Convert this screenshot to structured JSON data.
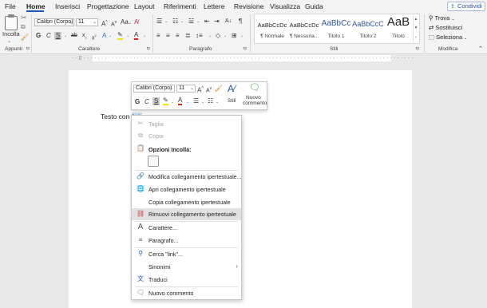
{
  "tabs": [
    "File",
    "Home",
    "Inserisci",
    "Progettazione",
    "Layout",
    "Riferimenti",
    "Lettere",
    "Revisione",
    "Visualizza",
    "Guida"
  ],
  "active_tab": "Home",
  "share_label": "Condividi",
  "clipboard": {
    "paste_label": "Incolla",
    "group_label": "Appunti"
  },
  "font": {
    "name": "Calibri (Corpo)",
    "size": "11",
    "group_label": "Carattere"
  },
  "paragraph": {
    "group_label": "Paragrafo"
  },
  "styles": {
    "group_label": "Stili",
    "items": [
      {
        "preview": "AaBbCcDc",
        "name": "¶ Normale"
      },
      {
        "preview": "AaBbCcDc",
        "name": "¶ Nessuna..."
      },
      {
        "preview": "AaBbCc",
        "name": "Titolo 1"
      },
      {
        "preview": "AaBbCcC",
        "name": "Titolo 2"
      },
      {
        "preview": "AaB",
        "name": "Titolo"
      }
    ]
  },
  "editing": {
    "find": "Trova",
    "replace": "Sostituisci",
    "select": "Seleziona",
    "group_label": "Modifica"
  },
  "document": {
    "text_before": "Testo con ",
    "link_text": "link"
  },
  "minibar": {
    "font_name": "Calibri (Corpo)",
    "font_size": "11",
    "styles_label": "Stili",
    "comment_label_1": "Nuovo",
    "comment_label_2": "commento"
  },
  "context_menu": {
    "cut": "Taglia",
    "copy": "Copia",
    "paste_options": "Opzioni Incolla:",
    "edit_link": "Modifica collegamento ipertestuale...",
    "open_link": "Apri collegamento ipertestuale",
    "copy_link": "Copia collegamento ipertestuale",
    "remove_link": "Rimuovi collegamento ipertestuale",
    "font": "Carattere...",
    "paragraph": "Paragrafo...",
    "search": "Cerca \"link\"...",
    "synonyms": "Sinonimi",
    "translate": "Traduci",
    "new_comment": "Nuovo commento"
  },
  "colors": {
    "accent": "#185abd",
    "link": "#1f5fbf",
    "highlight": "#e1e1e1",
    "font_color": "#e02020",
    "highlighter": "#f7e600"
  }
}
